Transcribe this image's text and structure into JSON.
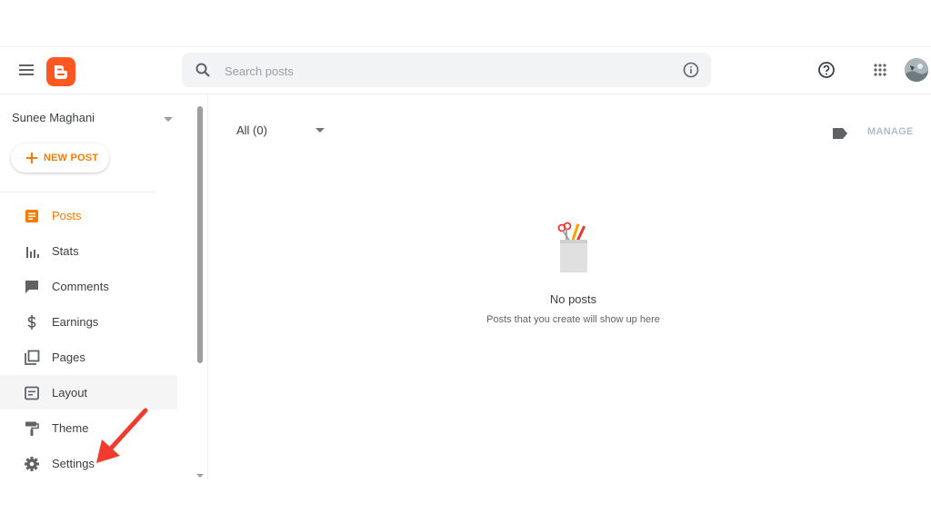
{
  "search": {
    "placeholder": "Search posts"
  },
  "sidebar": {
    "blog_name": "Sunee Maghani",
    "new_post_label": "NEW POST",
    "items": [
      {
        "label": "Posts",
        "icon": "posts-icon",
        "active": true
      },
      {
        "label": "Stats",
        "icon": "stats-icon"
      },
      {
        "label": "Comments",
        "icon": "comments-icon"
      },
      {
        "label": "Earnings",
        "icon": "dollar-icon"
      },
      {
        "label": "Pages",
        "icon": "pages-icon"
      },
      {
        "label": "Layout",
        "icon": "layout-icon"
      },
      {
        "label": "Theme",
        "icon": "paint-roller-icon"
      },
      {
        "label": "Settings",
        "icon": "gear-icon"
      }
    ]
  },
  "main": {
    "filter_label": "All (0)",
    "manage_label": "MANAGE",
    "empty_title": "No posts",
    "empty_subtitle": "Posts that you create will show up here"
  },
  "colors": {
    "accent": "#f57c00",
    "logo": "#ff5722",
    "annotation_arrow": "#f23b2f"
  }
}
